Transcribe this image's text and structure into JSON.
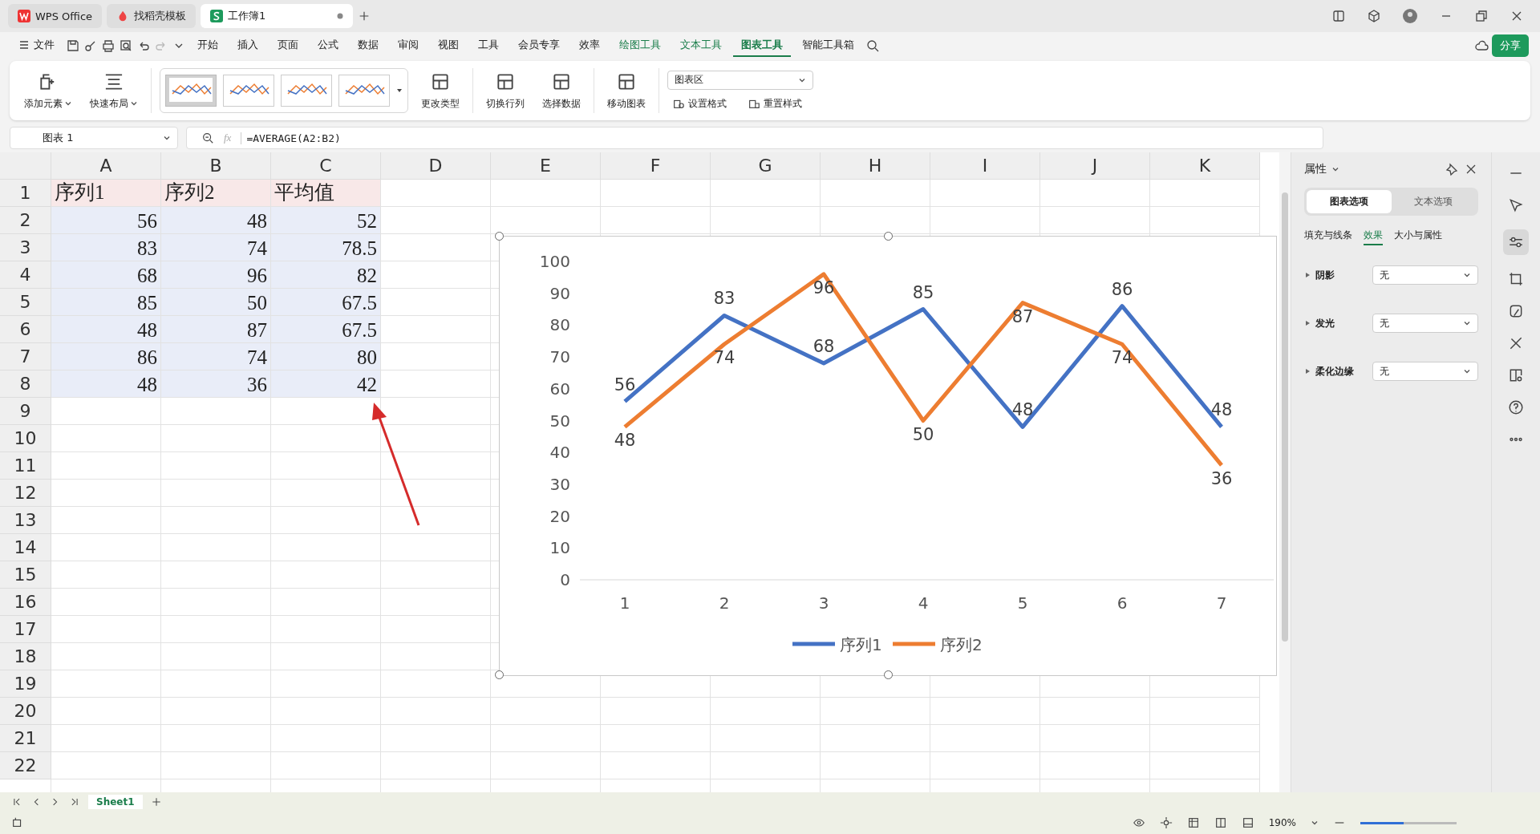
{
  "tabs": [
    {
      "label": "WPS Office",
      "selected": false,
      "kind": "wps"
    },
    {
      "label": "找稻壳模板",
      "selected": false,
      "kind": "docer"
    },
    {
      "label": "工作簿1",
      "selected": true,
      "kind": "sheet",
      "modified": true
    }
  ],
  "menu": {
    "file": "文件",
    "items": [
      {
        "label": "开始",
        "kind": "main",
        "selected": false
      },
      {
        "label": "插入",
        "kind": "main",
        "selected": false
      },
      {
        "label": "页面",
        "kind": "main",
        "selected": false
      },
      {
        "label": "公式",
        "kind": "main",
        "selected": false
      },
      {
        "label": "数据",
        "kind": "main",
        "selected": false
      },
      {
        "label": "审阅",
        "kind": "main",
        "selected": false
      },
      {
        "label": "视图",
        "kind": "main",
        "selected": false
      },
      {
        "label": "工具",
        "kind": "main",
        "selected": false
      },
      {
        "label": "会员专享",
        "kind": "main",
        "selected": false
      },
      {
        "label": "效率",
        "kind": "main",
        "selected": false
      },
      {
        "label": "绘图工具",
        "kind": "context",
        "selected": false
      },
      {
        "label": "文本工具",
        "kind": "context",
        "selected": false
      },
      {
        "label": "图表工具",
        "kind": "context",
        "selected": true
      },
      {
        "label": "智能工具箱",
        "kind": "main",
        "selected": false
      }
    ],
    "share": "分享"
  },
  "ribbon": {
    "add_element": "添加元素",
    "quick_layout": "快速布局",
    "styles": [
      {
        "selected": true
      },
      {
        "selected": false
      },
      {
        "selected": false
      },
      {
        "selected": false
      }
    ],
    "buttons": [
      "更改类型",
      "切换行列",
      "选择数据",
      "移动图表"
    ],
    "element_select": "图表区",
    "set_format": "设置格式",
    "reset_style": "重置样式"
  },
  "formula_bar": {
    "name_box": "图表 1",
    "fx_label": "fx",
    "formula": "=AVERAGE(A2:B2)"
  },
  "sheet": {
    "columns": [
      "A",
      "B",
      "C",
      "D",
      "E",
      "F",
      "G",
      "H",
      "I",
      "J",
      "K"
    ],
    "row_numbers": [
      "1",
      "2",
      "3",
      "4",
      "5",
      "6",
      "7",
      "8",
      "9",
      "10",
      "11",
      "12",
      "13",
      "14",
      "15",
      "16",
      "17",
      "18",
      "19",
      "20",
      "21",
      "22"
    ],
    "rows": [
      {
        "kind": "header",
        "cells": [
          "序列1",
          "序列2",
          "平均值"
        ]
      },
      {
        "kind": "data",
        "cells": [
          "56",
          "48",
          "52"
        ]
      },
      {
        "kind": "data",
        "cells": [
          "83",
          "74",
          "78.5"
        ]
      },
      {
        "kind": "data",
        "cells": [
          "68",
          "96",
          "82"
        ]
      },
      {
        "kind": "data",
        "cells": [
          "85",
          "50",
          "67.5"
        ]
      },
      {
        "kind": "data",
        "cells": [
          "48",
          "87",
          "67.5"
        ]
      },
      {
        "kind": "data",
        "cells": [
          "86",
          "74",
          "80"
        ]
      },
      {
        "kind": "data",
        "cells": [
          "48",
          "36",
          "42"
        ]
      }
    ]
  },
  "chart": {
    "chart_data": {
      "type": "line",
      "categories": [
        "1",
        "2",
        "3",
        "4",
        "5",
        "6",
        "7"
      ],
      "ylim": [
        0,
        100
      ],
      "yticks": [
        0,
        10,
        20,
        30,
        40,
        50,
        60,
        70,
        80,
        90,
        100
      ],
      "data_labels": true,
      "legend": "bottom",
      "series": [
        {
          "name": "序列1",
          "color": "#4472c4",
          "values": [
            56,
            83,
            68,
            85,
            48,
            86,
            48
          ]
        },
        {
          "name": "序列2",
          "color": "#ed7d31",
          "values": [
            48,
            74,
            96,
            50,
            87,
            74,
            36
          ]
        }
      ]
    }
  },
  "panel": {
    "title": "属性",
    "tabs": [
      {
        "label": "图表选项",
        "selected": true
      },
      {
        "label": "文本选项",
        "selected": false
      }
    ],
    "subtabs": [
      {
        "label": "填充与线条",
        "selected": false
      },
      {
        "label": "效果",
        "selected": true
      },
      {
        "label": "大小与属性",
        "selected": false
      }
    ],
    "rows": [
      {
        "label": "阴影",
        "value": "无"
      },
      {
        "label": "发光",
        "value": "无"
      },
      {
        "label": "柔化边缘",
        "value": "无"
      }
    ]
  },
  "sheet_tabs": [
    {
      "label": "Sheet1",
      "selected": true
    }
  ],
  "status_bar": {
    "zoom": "190%",
    "zoom_slider": {
      "level": 0.45
    }
  }
}
